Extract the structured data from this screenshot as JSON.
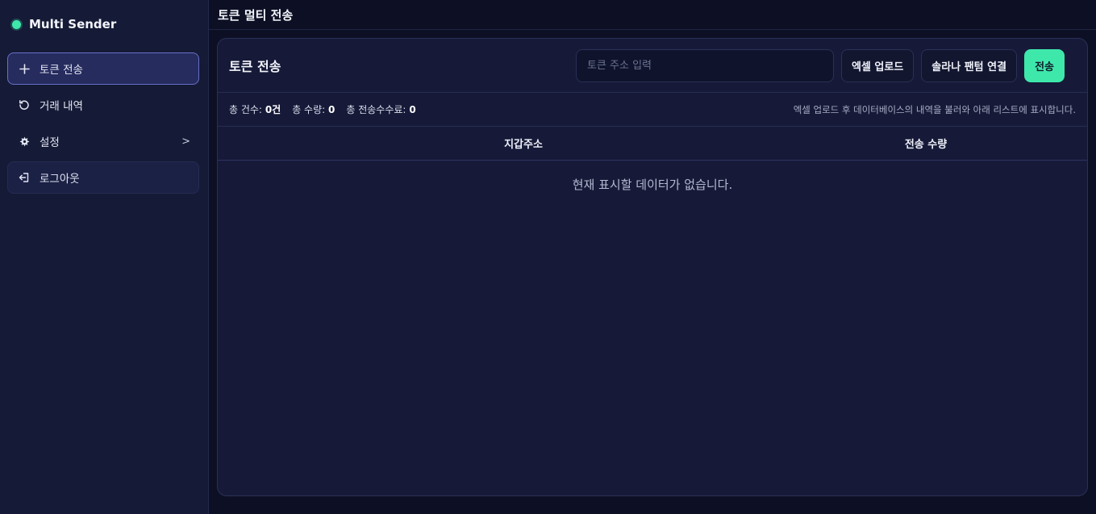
{
  "sidebar": {
    "brand": "Multi Sender",
    "items": [
      {
        "label": "토큰 전송",
        "icon": "plus-icon"
      },
      {
        "label": "거래 내역",
        "icon": "history-icon"
      },
      {
        "label": "설정",
        "icon": "gear-icon",
        "arrow": ">"
      },
      {
        "label": "로그아웃",
        "icon": "logout-icon"
      }
    ]
  },
  "header": {
    "title": "토큰 멀티 전송"
  },
  "card": {
    "title": "토큰 전송",
    "address_placeholder": "토큰 주소 입력",
    "address_value": "",
    "buttons": {
      "excel_upload": "엑셀 업로드",
      "phantom_connect": "솔라나 팬텀 연결",
      "send": "전송"
    },
    "stats": {
      "count_label": "총 건수:",
      "count_value": "0건",
      "amount_label": "총 수량:",
      "amount_value": "0",
      "fee_label": "총 전송수수료:",
      "fee_value": "0",
      "note": "엑셀 업로드 후 데이터베이스의 내역을 불러와 아래 리스트에 표시합니다."
    },
    "table": {
      "columns": [
        "지갑주소",
        "전송 수량"
      ],
      "empty_message": "현재 표시할 데이터가 없습니다."
    }
  },
  "colors": {
    "accent": "#3ee8ab",
    "background": "#0d1024",
    "sidebar": "#151a36",
    "card": "#161a38"
  }
}
